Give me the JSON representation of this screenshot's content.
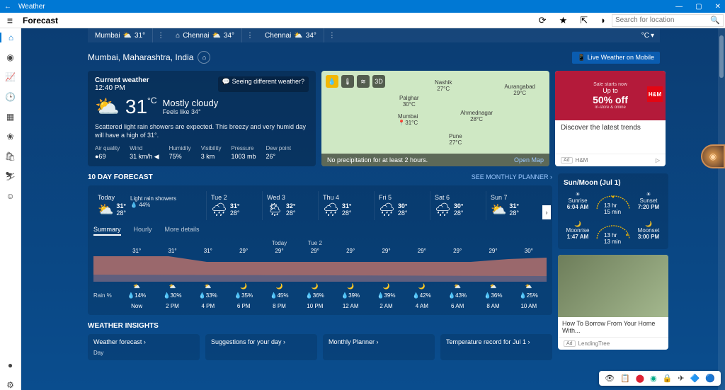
{
  "app": {
    "title": "Weather",
    "page": "Forecast",
    "search_placeholder": "Search for location"
  },
  "loc_tabs": [
    {
      "name": "Mumbai",
      "temp": "31°"
    },
    {
      "name": "Chennai",
      "temp": "34°"
    },
    {
      "name": "Chennai",
      "temp": "34°"
    }
  ],
  "unit_toggle": "°C",
  "location": "Mumbai, Maharashtra, India",
  "live_mobile": "Live Weather on Mobile",
  "current": {
    "label": "Current weather",
    "time": "12:40 PM",
    "link": "Seeing different weather?",
    "temp": "31",
    "unit": "°C",
    "condition": "Mostly cloudy",
    "feels": "Feels like  34°",
    "desc": "Scattered light rain showers are expected. This breezy and very humid day will have a high of 31°.",
    "stats": {
      "aq_l": "Air quality",
      "aq_v": "●69",
      "wind_l": "Wind",
      "wind_v": "31 km/h ◀",
      "hum_l": "Humidity",
      "hum_v": "75%",
      "vis_l": "Visibility",
      "vis_v": "3 km",
      "pres_l": "Pressure",
      "pres_v": "1003 mb",
      "dew_l": "Dew point",
      "dew_v": "26°"
    }
  },
  "map": {
    "cities": {
      "nashik": {
        "n": "Nashik",
        "t": "27°C"
      },
      "aurangabad": {
        "n": "Aurangabad",
        "t": "29°C"
      },
      "palghar": {
        "n": "Palghar",
        "t": "30°C"
      },
      "mumbai": {
        "n": "Mumbai",
        "t": "31°C"
      },
      "ahmednagar": {
        "n": "Ahmednagar",
        "t": "28°C"
      },
      "pune": {
        "n": "Pune",
        "t": "27°C"
      }
    },
    "note": "No precipitation for at least 2 hours.",
    "open": "Open Map"
  },
  "ad1": {
    "l1": "Sale starts now",
    "l2": "Up to",
    "l3": "50% off",
    "l4": "In-store & online",
    "brand": "H&M",
    "cap": "Discover the latest trends",
    "sponsor": "H&M",
    "tag": "Ad"
  },
  "forecast": {
    "title": "10 DAY FORECAST",
    "link": "SEE MONTHLY PLANNER ›"
  },
  "days": [
    {
      "name": "Today",
      "hi": "31°",
      "lo": "28°",
      "extra1": "Light rain showers",
      "extra2": "💧 44%"
    },
    {
      "name": "Tue 2",
      "hi": "31°",
      "lo": "28°"
    },
    {
      "name": "Wed 3",
      "hi": "32°",
      "lo": "28°"
    },
    {
      "name": "Thu 4",
      "hi": "31°",
      "lo": "28°"
    },
    {
      "name": "Fri 5",
      "hi": "30°",
      "lo": "28°"
    },
    {
      "name": "Sat 6",
      "hi": "30°",
      "lo": "28°"
    },
    {
      "name": "Sun 7",
      "hi": "31°",
      "lo": "28°"
    }
  ],
  "view_tabs": {
    "summary": "Summary",
    "hourly": "Hourly",
    "more": "More details"
  },
  "hourly_markers": {
    "today": "Today",
    "tue": "Tue 2"
  },
  "hourly_temps": [
    "31°",
    "31°",
    "31°",
    "29°",
    "29°",
    "29°",
    "29°",
    "29°",
    "29°",
    "29°",
    "29°",
    "30°"
  ],
  "hourly_rain_label": "Rain %",
  "hourly_rain": [
    "•",
    "💧14%",
    "💧30%",
    "💧33%",
    "💧35%",
    "💧45%",
    "💧36%",
    "💧39%",
    "💧39%",
    "💧42%",
    "💧43%",
    "💧36%",
    "💧25%"
  ],
  "hourly_times": [
    "Now",
    "2 PM",
    "4 PM",
    "6 PM",
    "8 PM",
    "10 PM",
    "12 AM",
    "2 AM",
    "4 AM",
    "6 AM",
    "8 AM",
    "10 AM"
  ],
  "sunmoon": {
    "title": "Sun/Moon (Jul 1)",
    "sunrise_l": "Sunrise",
    "sunrise_v": "6:04 AM",
    "sunset_l": "Sunset",
    "sunset_v": "7:20 PM",
    "day_dur": "13 hr 15 min",
    "moonrise_l": "Moonrise",
    "moonrise_v": "1:47 AM",
    "moonset_l": "Moonset",
    "moonset_v": "3:00 PM",
    "night_dur": "13 hr 13 min"
  },
  "ad2": {
    "cap": "How To Borrow From Your Home With...",
    "sponsor": "LendingTree",
    "tag": "Ad"
  },
  "insights_title": "WEATHER INSIGHTS",
  "insights": [
    "Weather forecast ›",
    "Suggestions for your day ›",
    "Monthly Planner ›",
    "Temperature record for Jul 1 ›"
  ],
  "insight_sub": "Day"
}
